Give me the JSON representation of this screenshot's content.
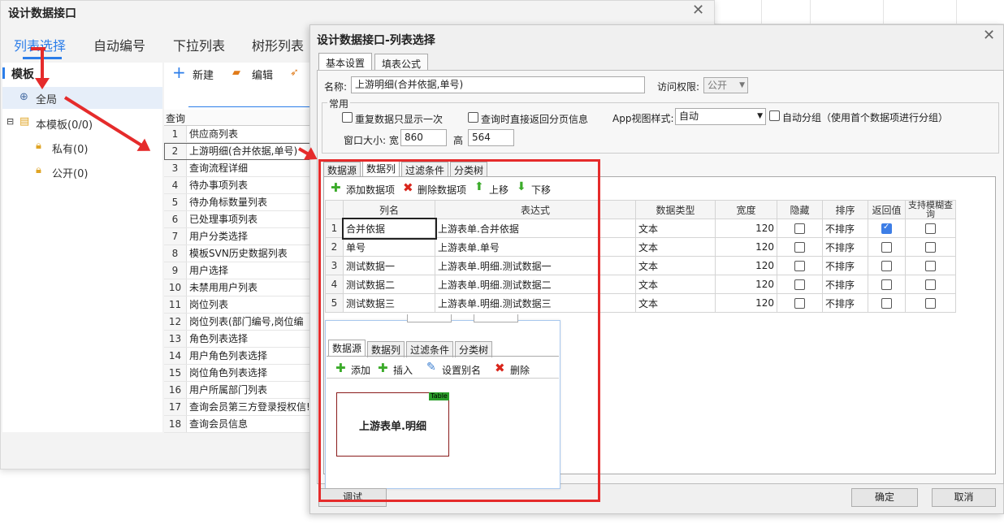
{
  "win1": {
    "title": "设计数据接口",
    "tabs": [
      "列表选择",
      "自动编号",
      "下拉列表",
      "树形列表"
    ],
    "left": {
      "header": "模板",
      "items": [
        "全局",
        "本模板(0/0)",
        "私有(0)",
        "公开(0)"
      ]
    },
    "toolbar": {
      "new": "新建",
      "edit": "编辑"
    },
    "col_header": "查询",
    "rows": [
      {
        "n": "1",
        "t": "供应商列表"
      },
      {
        "n": "2",
        "t": "上游明细(合并依据,单号)"
      },
      {
        "n": "3",
        "t": "查询流程详细"
      },
      {
        "n": "4",
        "t": "待办事项列表"
      },
      {
        "n": "5",
        "t": "待办角标数量列表"
      },
      {
        "n": "6",
        "t": "已处理事项列表"
      },
      {
        "n": "7",
        "t": "用户分类选择"
      },
      {
        "n": "8",
        "t": "模板SVN历史数据列表"
      },
      {
        "n": "9",
        "t": "用户选择"
      },
      {
        "n": "10",
        "t": "未禁用用户列表"
      },
      {
        "n": "11",
        "t": "岗位列表"
      },
      {
        "n": "12",
        "t": "岗位列表(部门编号,岗位编号"
      },
      {
        "n": "13",
        "t": "角色列表选择"
      },
      {
        "n": "14",
        "t": "用户角色列表选择"
      },
      {
        "n": "15",
        "t": "岗位角色列表选择"
      },
      {
        "n": "16",
        "t": "用户所属部门列表"
      },
      {
        "n": "17",
        "t": "查询会员第三方登录授权信!"
      },
      {
        "n": "18",
        "t": "查询会员信息"
      }
    ]
  },
  "win2": {
    "title": "设计数据接口-列表选择",
    "tabs": [
      "基本设置",
      "填表公式"
    ],
    "name_label": "名称:",
    "name_value": "上游明细(合并依据,单号)",
    "access_label": "访问权限:",
    "access_value": "公开",
    "group_label": "常用",
    "opt1": "重复数据只显示一次",
    "opt2": "查询时直接返回分页信息",
    "app_style_label": "App视图样式:",
    "app_style_value": "自动",
    "auto_group": "自动分组（使用首个数据项进行分组）",
    "size_label": "窗口大小: 宽",
    "width": "860",
    "height_label": "高",
    "height": "564",
    "inner_tabs": [
      "数据源",
      "数据列",
      "过滤条件",
      "分类树"
    ],
    "inner_toolbar": {
      "add": "添加数据项",
      "del": "删除数据项",
      "up": "上移",
      "down": "下移"
    },
    "columns": [
      "列名",
      "表达式",
      "数据类型",
      "宽度",
      "隐藏",
      "排序",
      "返回值",
      "支持模糊查询"
    ],
    "rows": [
      {
        "n": "1",
        "name": "合并依据",
        "expr": "上游表单.合并依据",
        "type": "文本",
        "width": "120",
        "hidden": false,
        "sort": "不排序",
        "ret": true,
        "fuzzy": false
      },
      {
        "n": "2",
        "name": "单号",
        "expr": "上游表单.单号",
        "type": "文本",
        "width": "120",
        "hidden": false,
        "sort": "不排序",
        "ret": false,
        "fuzzy": false
      },
      {
        "n": "3",
        "name": "测试数据一",
        "expr": "上游表单.明细.测试数据一",
        "type": "文本",
        "width": "120",
        "hidden": false,
        "sort": "不排序",
        "ret": false,
        "fuzzy": false
      },
      {
        "n": "4",
        "name": "测试数据二",
        "expr": "上游表单.明细.测试数据二",
        "type": "文本",
        "width": "120",
        "hidden": false,
        "sort": "不排序",
        "ret": false,
        "fuzzy": false
      },
      {
        "n": "5",
        "name": "测试数据三",
        "expr": "上游表单.明细.测试数据三",
        "type": "文本",
        "width": "120",
        "hidden": false,
        "sort": "不排序",
        "ret": false,
        "fuzzy": false
      }
    ],
    "popup": {
      "tabs": [
        "数据源",
        "数据列",
        "过滤条件",
        "分类树"
      ],
      "toolbar": {
        "add": "添加",
        "insert": "插入",
        "alias": "设置别名",
        "del": "删除"
      },
      "table_tag": "Table",
      "table_name": "上游表单.明细"
    },
    "debug": "调试",
    "ok": "确定",
    "cancel": "取消"
  },
  "colors": {
    "accent": "#2b7de9",
    "annotation": "#e52b2b"
  }
}
